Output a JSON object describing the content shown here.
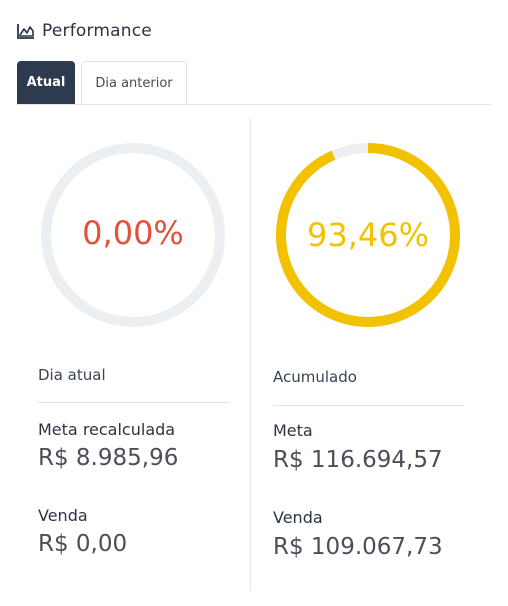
{
  "header": {
    "title": "Performance",
    "icon": "area-chart-icon"
  },
  "tabs": [
    {
      "label": "Atual",
      "active": true
    },
    {
      "label": "Dia anterior",
      "active": false
    }
  ],
  "left_panel": {
    "gauge": {
      "value_text": "0,00%",
      "progress": 0.0,
      "color": "#e2523a",
      "track_color": "#eceff1"
    },
    "section_label": "Dia atual",
    "stats": [
      {
        "label": "Meta recalculada",
        "value": "R$ 8.985,96"
      },
      {
        "label": "Venda",
        "value": "R$ 0,00"
      }
    ]
  },
  "right_panel": {
    "gauge": {
      "value_text": "93,46%",
      "progress": 0.9346,
      "color": "#f2c200",
      "track_color": "#eceff1"
    },
    "section_label": "Acumulado",
    "stats": [
      {
        "label": "Meta",
        "value": "R$ 116.694,57"
      },
      {
        "label": "Venda",
        "value": "R$ 109.067,73"
      }
    ]
  }
}
